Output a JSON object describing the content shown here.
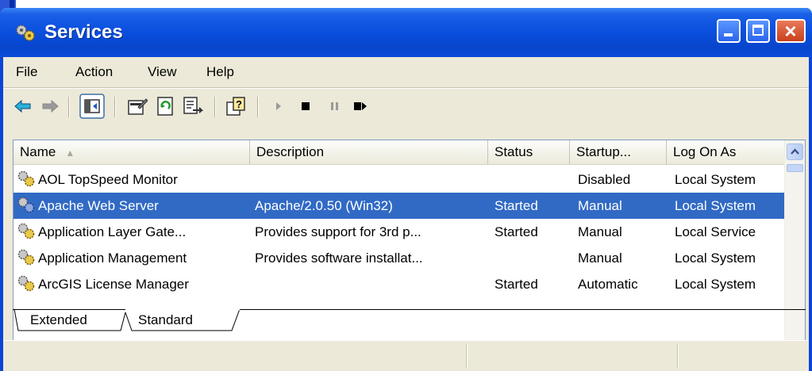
{
  "window": {
    "title": "Services",
    "icon": "services-gears-icon",
    "controls": [
      "minimize-icon",
      "maximize-icon",
      "close-icon"
    ]
  },
  "menu": [
    {
      "label": "File"
    },
    {
      "label": "Action"
    },
    {
      "label": "View"
    },
    {
      "label": "Help"
    }
  ],
  "toolbar": {
    "icons": [
      "back-arrow-icon",
      "forward-arrow-icon",
      "show-hide-console-tree-icon",
      "properties-icon",
      "refresh-icon",
      "export-list-icon",
      "help-icon",
      "start-service-icon",
      "stop-service-icon",
      "pause-service-icon",
      "restart-service-icon"
    ]
  },
  "list": {
    "columns": [
      "Name",
      "Description",
      "Status",
      "Startup...",
      "Log On As"
    ],
    "sort_column": "Name",
    "rows": [
      {
        "name": "AOL TopSpeed Monitor",
        "description": "",
        "status": "",
        "startup": "Disabled",
        "logon": "Local System",
        "selected": false
      },
      {
        "name": "Apache Web Server",
        "description": "Apache/2.0.50 (Win32)",
        "status": "Started",
        "startup": "Manual",
        "logon": "Local System",
        "selected": true
      },
      {
        "name": "Application Layer Gate...",
        "description": "Provides support for 3rd p...",
        "status": "Started",
        "startup": "Manual",
        "logon": "Local Service",
        "selected": false
      },
      {
        "name": "Application Management",
        "description": "Provides software installat...",
        "status": "",
        "startup": "Manual",
        "logon": "Local System",
        "selected": false
      },
      {
        "name": "ArcGIS License Manager",
        "description": "",
        "status": "Started",
        "startup": "Automatic",
        "logon": "Local System",
        "selected": false
      }
    ]
  },
  "tabs": [
    {
      "label": "Extended",
      "active": false
    },
    {
      "label": "Standard",
      "active": true
    }
  ],
  "colors": {
    "titlebar": "#0a4fde",
    "selection": "#316ac5",
    "close_button": "#d4502c"
  }
}
